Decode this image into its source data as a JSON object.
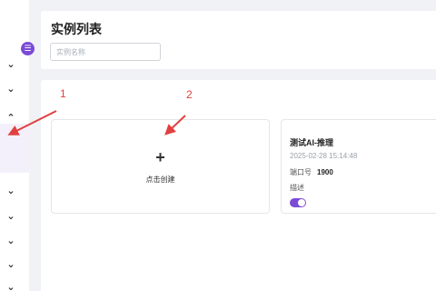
{
  "header": {
    "title": "实例列表",
    "search_placeholder": "实例名称"
  },
  "create_card": {
    "plus_icon": "+",
    "label": "点击创建"
  },
  "instance": {
    "name": "测试AI-推理",
    "created_at": "2025-02-28 15:14:48",
    "port_label": "端口号",
    "port_value": "1900",
    "desc_label": "描述",
    "enabled": true
  },
  "sidebar": {
    "toggle_icon": "list-collapse-icon",
    "chevrons": [
      "⌄",
      "⌄",
      "⌃",
      "⌄",
      "⌄",
      "⌄",
      "⌄",
      "⌄"
    ]
  },
  "annotations": {
    "num1": "1",
    "num2": "2"
  },
  "colors": {
    "accent": "#7b4bd6",
    "annotation": "#e24040",
    "background": "#f0f2f5"
  }
}
